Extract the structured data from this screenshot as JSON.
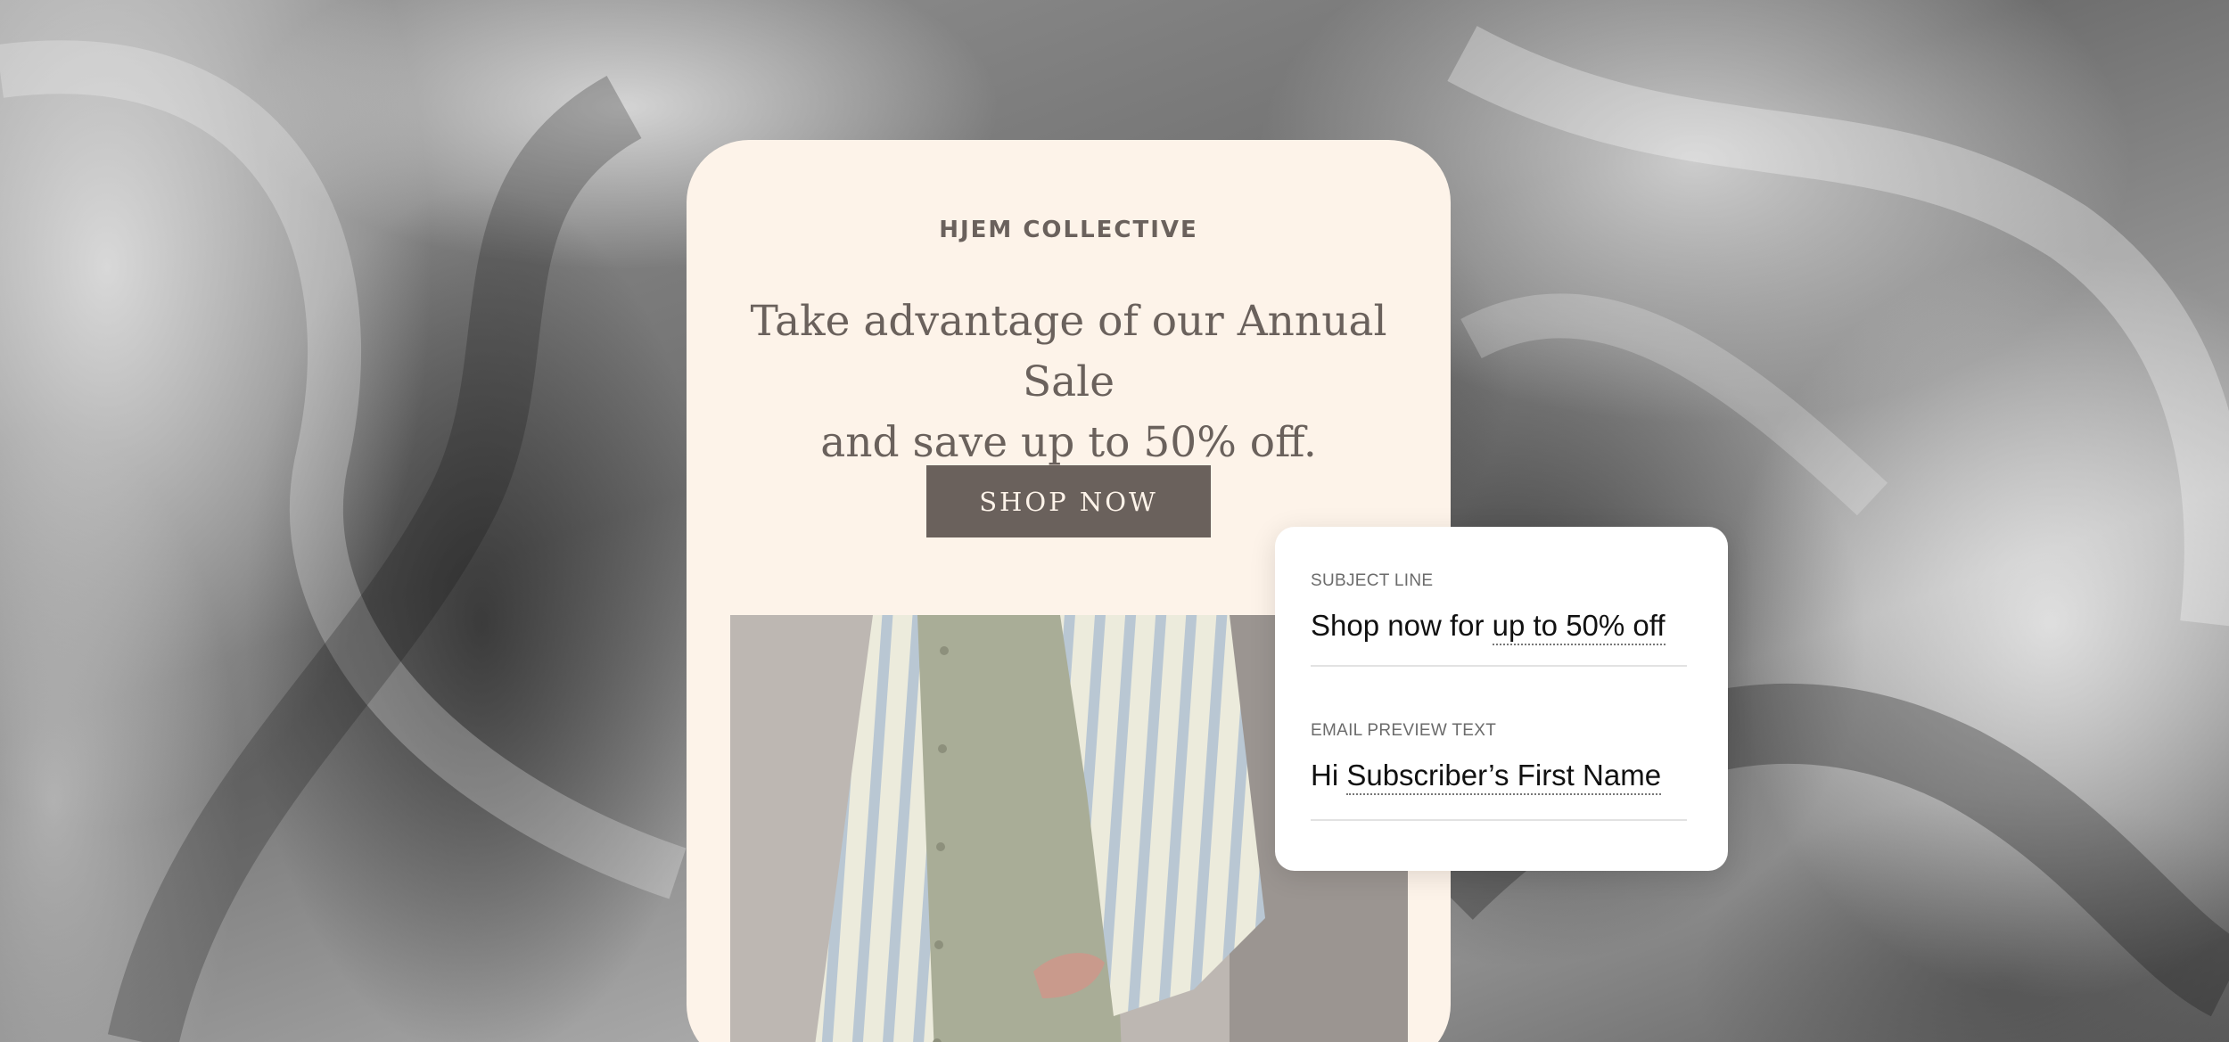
{
  "email": {
    "brand": "HJEM COLLECTIVE",
    "headline_line1": "Take advantage of our Annual Sale",
    "headline_line2": "and save up to 50% off.",
    "cta_label": "SHOP NOW"
  },
  "meta_panel": {
    "subject_label": "SUBJECT LINE",
    "subject_prefix": "Shop now for",
    "subject_token": "up to 50% off",
    "preview_label": "EMAIL PREVIEW TEXT",
    "preview_prefix": "Hi",
    "preview_token": "Subscriber’s First Name"
  },
  "colors": {
    "card_background": "#fdf3e9",
    "brand_text": "#6a615c",
    "cta_background": "#6a615c",
    "panel_background": "#ffffff"
  }
}
